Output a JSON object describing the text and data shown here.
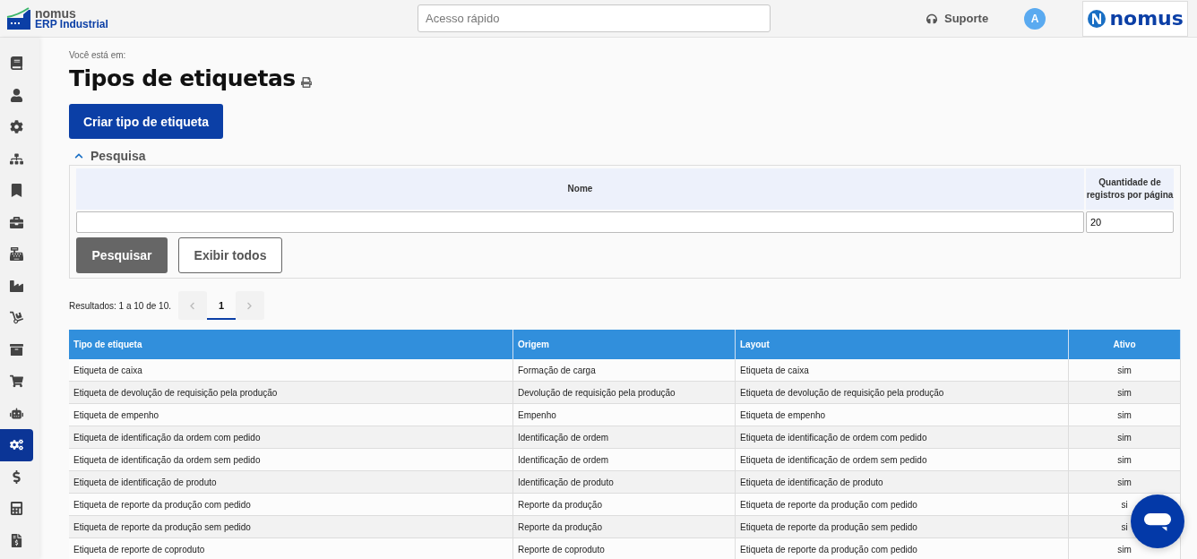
{
  "header": {
    "logo_name": "nomus",
    "logo_sub": "ERP Industrial",
    "quick_access": {
      "placeholder": "Acesso rápido"
    },
    "support": "Suporte",
    "avatar": "A",
    "brand": "nomus"
  },
  "sidebar": {
    "items": [
      {
        "selected": false
      },
      {
        "selected": false
      },
      {
        "selected": false
      },
      {
        "selected": false
      },
      {
        "selected": false
      },
      {
        "selected": false
      },
      {
        "selected": false
      },
      {
        "selected": false
      },
      {
        "selected": false
      },
      {
        "selected": false
      },
      {
        "selected": false
      },
      {
        "selected": false
      },
      {
        "selected": true
      },
      {
        "selected": false
      },
      {
        "selected": false
      },
      {
        "selected": false
      }
    ]
  },
  "breadcrumb": "Você está em:",
  "title": "Tipos de etiquetas",
  "create_button": "Criar tipo de etiqueta",
  "search_panel": {
    "title": "Pesquisa",
    "expanded": true,
    "columns": [
      "Nome",
      "Quantidade de registros por página"
    ],
    "page_size": "20",
    "search_button": "Pesquisar",
    "show_all_button": "Exibir todos"
  },
  "results": {
    "summary": "Resultados: 1 a 10 de 10.",
    "pages": [
      {
        "label": "1",
        "selected": true
      }
    ]
  },
  "table": {
    "columns": [
      "Tipo de etiqueta",
      "Origem",
      "Layout",
      "Ativo"
    ],
    "rows": [
      [
        "Etiqueta de caixa",
        "Formação de carga",
        "Etiqueta de caixa",
        "sim"
      ],
      [
        "Etiqueta de devolução de requisição pela produção",
        "Devolução de requisição pela produção",
        "Etiqueta de devolução de requisição pela produção",
        "sim"
      ],
      [
        "Etiqueta de empenho",
        "Empenho",
        "Etiqueta de empenho",
        "sim"
      ],
      [
        "Etiqueta de identificação da ordem com pedido",
        "Identificação de ordem",
        "Etiqueta de identificação de ordem com pedido",
        "sim"
      ],
      [
        "Etiqueta de identificação da ordem sem pedido",
        "Identificação de ordem",
        "Etiqueta de identificação de ordem sem pedido",
        "sim"
      ],
      [
        "Etiqueta de identificação de produto",
        "Identificação de produto",
        "Etiqueta de identificação de produto",
        "sim"
      ],
      [
        "Etiqueta de reporte da produção com pedido",
        "Reporte da produção",
        "Etiqueta de reporte da produção com pedido",
        "si"
      ],
      [
        "Etiqueta de reporte da produção sem pedido",
        "Reporte da produção",
        "Etiqueta de reporte da produção sem pedido",
        "si"
      ],
      [
        "Etiqueta de reporte de coproduto",
        "Reporte de coproduto",
        "Etiqueta de reporte da produção com pedido",
        "sim"
      ]
    ]
  }
}
